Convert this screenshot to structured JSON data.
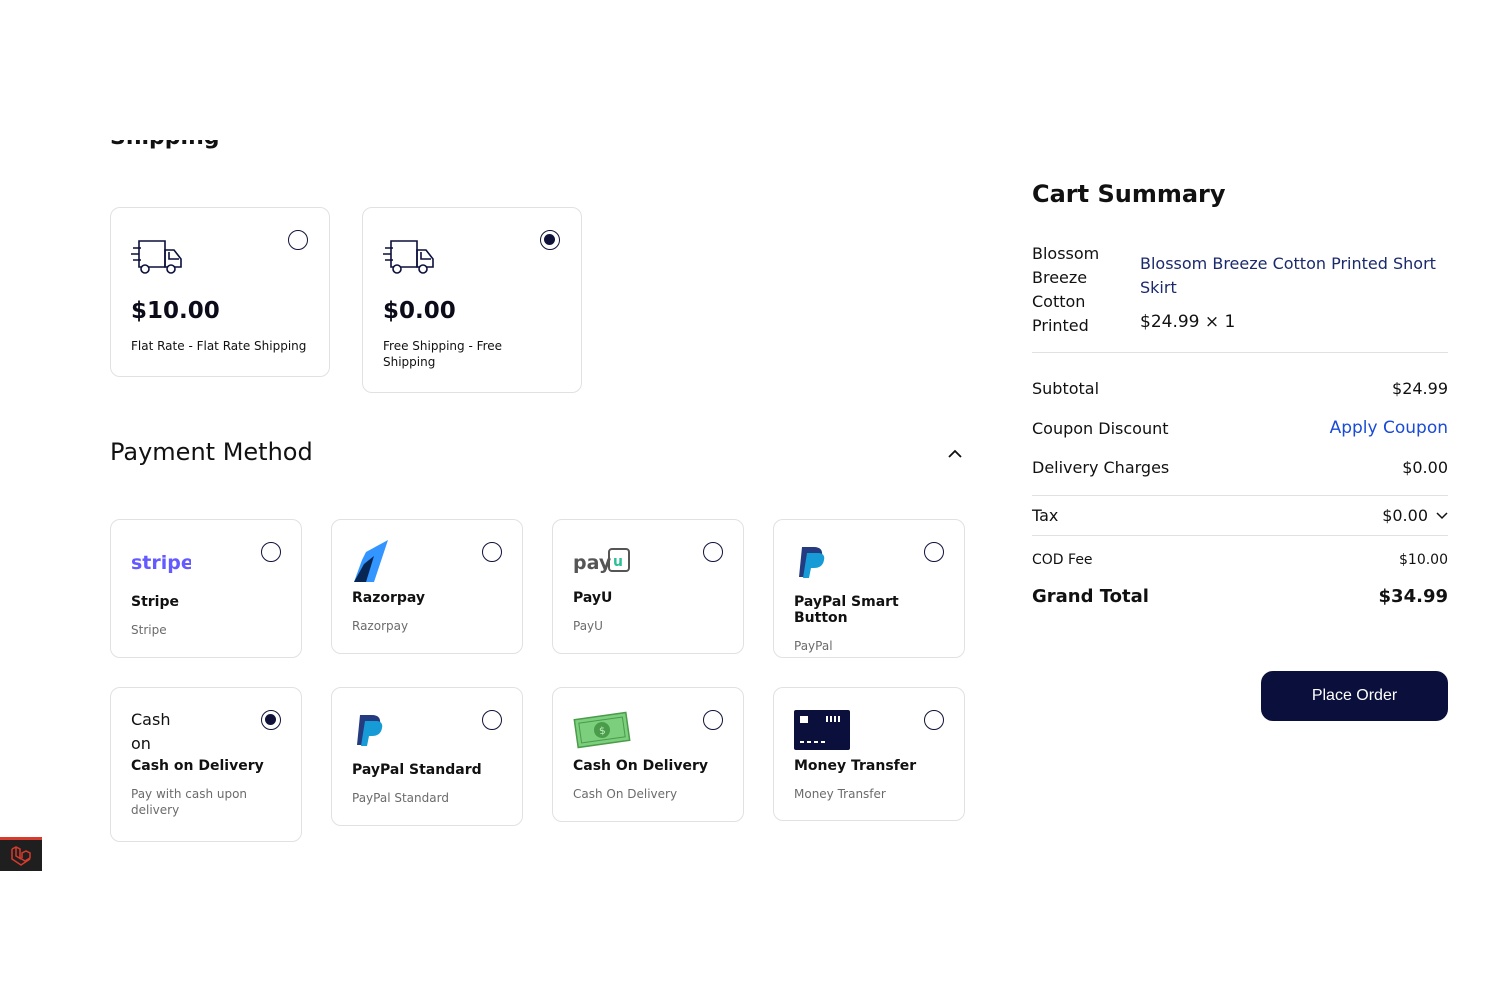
{
  "shipping": {
    "heading_cut": "Shipping",
    "options": [
      {
        "price": "$10.00",
        "desc": "Flat Rate - Flat Rate Shipping",
        "checked": false
      },
      {
        "price": "$0.00",
        "desc": "Free Shipping - Free Shipping",
        "checked": true
      }
    ]
  },
  "payment": {
    "title": "Payment Method",
    "methods": [
      {
        "logo": "stripe",
        "name": "Stripe",
        "sub": "Stripe",
        "checked": false
      },
      {
        "logo": "razorpay-icon",
        "name": "Razorpay",
        "sub": "Razorpay",
        "checked": false
      },
      {
        "logo": "payu",
        "name": "PayU",
        "sub": "PayU",
        "checked": false
      },
      {
        "logo": "paypal-icon",
        "name": "PayPal Smart Button",
        "sub": "PayPal",
        "checked": false
      },
      {
        "logo_text": "Cash on",
        "name": "Cash on Delivery",
        "sub": "Pay with cash upon delivery",
        "checked": true
      },
      {
        "logo": "paypal-icon",
        "name": "PayPal Standard",
        "sub": "PayPal Standard",
        "checked": false
      },
      {
        "logo": "cash-icon",
        "name": "Cash On Delivery",
        "sub": "Cash On Delivery",
        "checked": false
      },
      {
        "logo": "card-icon",
        "name": "Money Transfer",
        "sub": "Money Transfer",
        "checked": false
      }
    ]
  },
  "cart": {
    "title": "Cart Summary",
    "item": {
      "img_alt": "Blossom Breeze Cotton Printed",
      "name": "Blossom Breeze Cotton Printed Short Skirt",
      "price_qty": "$24.99 × 1"
    },
    "subtotal_label": "Subtotal",
    "subtotal": "$24.99",
    "coupon_label": "Coupon Discount",
    "coupon_action": "Apply Coupon",
    "delivery_label": "Delivery Charges",
    "delivery": "$0.00",
    "tax_label": "Tax",
    "tax": "$0.00",
    "cod_label": "COD Fee",
    "cod": "$10.00",
    "grand_label": "Grand Total",
    "grand": "$34.99",
    "place_order": "Place Order"
  },
  "colors": {
    "primary": "#0b0f3b",
    "link": "#1a4bd6",
    "stripe": "#635bff",
    "laravel": "#d63b2d"
  }
}
